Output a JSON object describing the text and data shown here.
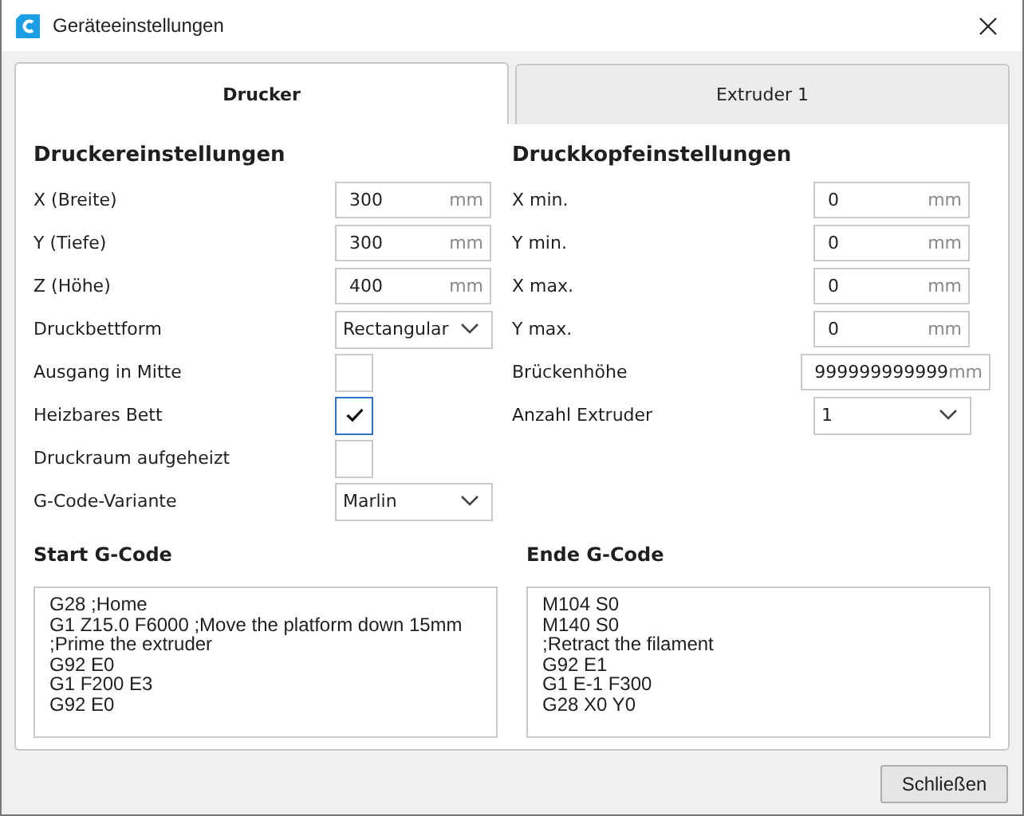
{
  "window": {
    "title": "Geräteeinstellungen"
  },
  "tabs": [
    {
      "label": "Drucker",
      "selected": true
    },
    {
      "label": "Extruder 1",
      "selected": false
    }
  ],
  "sections": [
    {
      "title": "Druckereinstellungen",
      "rows": [
        {
          "kind": "number",
          "label": "X (Breite)",
          "value": "300",
          "unit": "mm"
        },
        {
          "kind": "number",
          "label": "Y (Tiefe)",
          "value": "300",
          "unit": "mm"
        },
        {
          "kind": "number",
          "label": "Z (Höhe)",
          "value": "400",
          "unit": "mm"
        },
        {
          "kind": "dropdown",
          "label": "Druckbettform",
          "value": "Rectangular"
        },
        {
          "kind": "checkbox",
          "label": "Ausgang in Mitte",
          "checked": false
        },
        {
          "kind": "checkbox",
          "label": "Heizbares Bett",
          "checked": true
        },
        {
          "kind": "checkbox",
          "label": "Druckraum aufgeheizt",
          "checked": false
        },
        {
          "kind": "dropdown",
          "label": "G-Code-Variante",
          "value": "Marlin"
        }
      ]
    },
    {
      "title": "Druckkopfeinstellungen",
      "rows": [
        {
          "kind": "number",
          "label": "X min.",
          "value": "0",
          "unit": "mm"
        },
        {
          "kind": "number",
          "label": "Y min.",
          "value": "0",
          "unit": "mm"
        },
        {
          "kind": "number",
          "label": "X max.",
          "value": "0",
          "unit": "mm"
        },
        {
          "kind": "number",
          "label": "Y max.",
          "value": "0",
          "unit": "mm"
        },
        {
          "kind": "number",
          "label": "Brückenhöhe",
          "value": "999999999999",
          "unit": "mm"
        },
        {
          "kind": "dropdown",
          "label": "Anzahl Extruder",
          "value": "1"
        }
      ]
    }
  ],
  "gcode": [
    {
      "title": "Start G-Code",
      "lines": [
        "G28 ;Home",
        "G1 Z15.0 F6000 ;Move the platform down 15mm",
        ";Prime the extruder",
        "G92 E0",
        "G1 F200 E3",
        "G92 E0"
      ]
    },
    {
      "title": "Ende G-Code",
      "lines": [
        "M104 S0",
        "M140 S0",
        ";Retract the filament",
        "G92 E1",
        "G1 E-1 F300",
        "G28 X0 Y0"
      ]
    }
  ],
  "buttons": [
    {
      "label": "Schließen"
    }
  ]
}
